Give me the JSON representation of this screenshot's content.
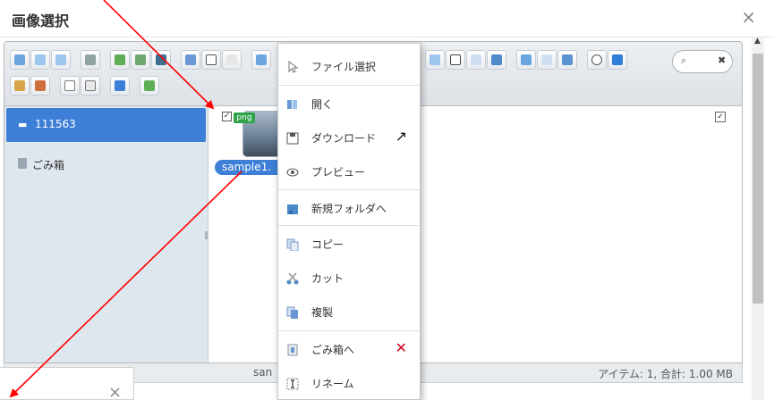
{
  "dialog": {
    "title": "画像選択",
    "close_glyph": "×"
  },
  "colors": {
    "selection": "#3d7ed6",
    "annotation_arrow": "#ff0000",
    "png_badge": "#2ea34a"
  },
  "toolbar": {
    "icons": [
      "back-icon",
      "forward-icon",
      "up-icon",
      "reload-icon",
      "home-icon",
      "save-icon",
      "open-icon",
      "getfile-icon",
      "select-icon",
      "undo-icon",
      "copy-icon",
      "cut-icon",
      "paste-icon",
      "resize-icon",
      "view-icons-icon",
      "view-list-icon",
      "sort-icon",
      "preview-eye-icon",
      "info-icon",
      "rename-icon",
      "edit-icon",
      "archive-icon",
      "extract-icon",
      "help-icon",
      "fullscreen-icon"
    ],
    "search": {
      "glyph": "⌕",
      "clear_glyph": "✖"
    }
  },
  "sidebar": {
    "items": [
      {
        "label": "111563",
        "icon": "volume-icon",
        "selected": true
      },
      {
        "label": "ごみ箱",
        "icon": "trash-icon",
        "selected": false
      }
    ]
  },
  "files": [
    {
      "name": "sample1.",
      "type_badge": "png",
      "checked": true
    }
  ],
  "select_all_checked": true,
  "status": {
    "path_fragment": "san",
    "summary": "アイテム: 1, 合計: 1.00 MB"
  },
  "context_menu": {
    "items": [
      {
        "label": "ファイル選択",
        "icon": "cursor-select-icon"
      },
      {
        "label": "開く",
        "icon": "open-book-icon"
      },
      {
        "label": "ダウンロード",
        "icon": "save-disk-icon",
        "extra": "↗",
        "extra_icon": "external-arrow-icon"
      },
      {
        "label": "プレビュー",
        "icon": "eye-icon"
      },
      {
        "label": "新規フォルダへ",
        "icon": "new-folder-icon"
      },
      {
        "label": "コピー",
        "icon": "copy-icon"
      },
      {
        "label": "カット",
        "icon": "scissors-icon"
      },
      {
        "label": "複製",
        "icon": "duplicate-icon"
      },
      {
        "label": "ごみ箱へ",
        "icon": "trash-bin-icon",
        "extra": "✕",
        "extra_icon": "delete-x-icon"
      },
      {
        "label": "リネーム",
        "icon": "rename-cursor-icon"
      }
    ]
  },
  "bottom_dialog": {
    "close_glyph": "×"
  }
}
